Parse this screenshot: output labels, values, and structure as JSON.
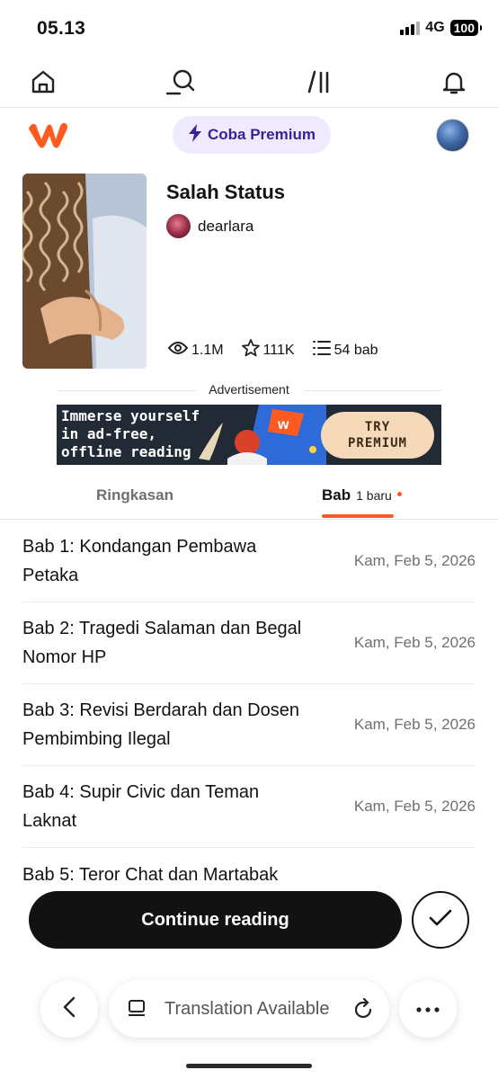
{
  "status_bar": {
    "time": "05.13",
    "network": "4G",
    "battery": "100"
  },
  "top_nav": {
    "items": [
      {
        "icon": "home-icon"
      },
      {
        "icon": "search-icon"
      },
      {
        "icon": "library-icon"
      },
      {
        "icon": "bell-icon"
      }
    ]
  },
  "header": {
    "premium_label": "Coba Premium",
    "accent": "#ff5a1f",
    "premium_bg": "#efeafd"
  },
  "story": {
    "title": "Salah Status",
    "author": "dearlara",
    "reads": "1.1M",
    "votes": "111K",
    "parts": "54 bab"
  },
  "ad": {
    "label": "Advertisement",
    "lines": [
      "Immerse yourself",
      "in ad-free,",
      "offline reading"
    ],
    "cta_line1": "TRY",
    "cta_line2": "PREMIUM"
  },
  "tabs": {
    "summary": "Ringkasan",
    "chapters": "Bab",
    "new_badge": "1 baru"
  },
  "chapters": [
    {
      "title": "Bab 1: Kondangan Pembawa Petaka",
      "date": "Kam, Feb 5, 2026"
    },
    {
      "title": "Bab 2: Tragedi Salaman dan Begal Nomor HP",
      "date": "Kam, Feb 5, 2026"
    },
    {
      "title": "Bab 3: Revisi Berdarah dan Dosen Pembimbing Ilegal",
      "date": "Kam, Feb 5, 2026"
    },
    {
      "title": "Bab 4: Supir Civic dan Teman Laknat",
      "date": "Kam, Feb 5, 2026"
    },
    {
      "title": "Bab 5: Teror Chat dan Martabak",
      "date": ""
    }
  ],
  "actions": {
    "continue_label": "Continue reading"
  },
  "browser_bar": {
    "text": "Translation Available"
  }
}
